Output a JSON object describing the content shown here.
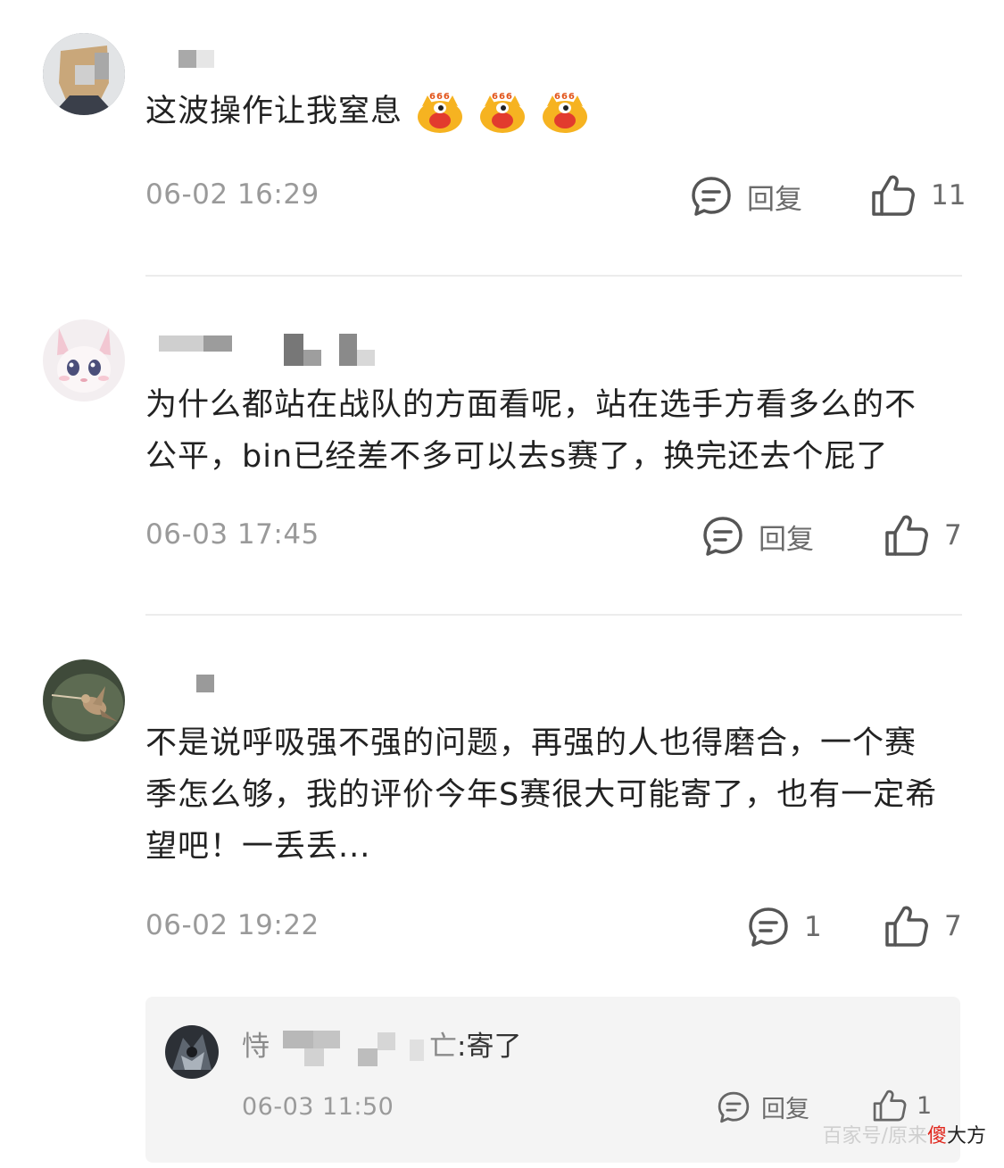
{
  "comments": [
    {
      "text": "这波操作让我窒息",
      "time": "06-02 16:29",
      "reply_label": "回复",
      "likes": "11",
      "emoji": [
        "666-emoji",
        "666-emoji",
        "666-emoji"
      ]
    },
    {
      "text_line1": "为什么都站在战队的方面看呢，站在选手方看多么的不",
      "text_line2": "公平，bin已经差不多可以去s赛了，换完还去个屁了",
      "time": "06-03 17:45",
      "reply_label": "回复",
      "likes": "7"
    },
    {
      "text_line1": "不是说呼吸强不强的问题，再强的人也得磨合，一个赛",
      "text_line2": "季怎么够，我的评价今年S赛很大可能寄了，也有一定希",
      "text_line3": "望吧！一丢丢...",
      "time": "06-02 19:22",
      "reply_count": "1",
      "likes": "7",
      "reply": {
        "name_prefix": "恃",
        "name_suffix": "亡",
        "text": ":寄了",
        "time": "06-03 11:50",
        "reply_label": "回复",
        "likes": "1"
      }
    }
  ],
  "watermark": {
    "text": "百家号/原来",
    "brand_char": "傻",
    "brand_rest": "大方"
  },
  "colors": {
    "text": "#222222",
    "muted": "#9a9a9a",
    "icon": "#6b6b6b",
    "divider": "#ececec",
    "reply_bg": "#f4f4f4",
    "brand_red": "#e0251b"
  }
}
